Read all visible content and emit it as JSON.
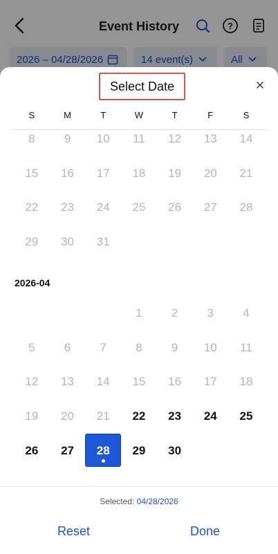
{
  "background": {
    "title": "Event History",
    "date_range": "2026 – 04/28/2026",
    "event_count": "14 event(s)",
    "filter_all": "All"
  },
  "sheet": {
    "title": "Select Date",
    "weekdays": [
      "S",
      "M",
      "T",
      "W",
      "T",
      "F",
      "S"
    ],
    "month_label": "2026-04",
    "previous_month_rows": [
      [
        "8",
        "9",
        "10",
        "11",
        "12",
        "13",
        "14"
      ],
      [
        "15",
        "16",
        "17",
        "18",
        "19",
        "20",
        "21"
      ],
      [
        "22",
        "23",
        "24",
        "25",
        "26",
        "27",
        "28"
      ],
      [
        "29",
        "30",
        "31",
        "",
        "",
        "",
        ""
      ]
    ],
    "april_rows": [
      [
        "",
        "",
        "",
        "1",
        "2",
        "3",
        "4"
      ],
      [
        "5",
        "6",
        "7",
        "8",
        "9",
        "10",
        "11"
      ],
      [
        "12",
        "13",
        "14",
        "15",
        "16",
        "17",
        "18"
      ],
      [
        "19",
        "20",
        "21",
        "22",
        "23",
        "24",
        "25"
      ],
      [
        "26",
        "27",
        "28",
        "29",
        "30",
        "",
        ""
      ]
    ],
    "active_days": [
      "22",
      "23",
      "24",
      "25",
      "26",
      "27",
      "28",
      "29",
      "30"
    ],
    "selected_day": "28",
    "selected_label": "Selected:",
    "selected_value": "04/28/2026",
    "reset_label": "Reset",
    "done_label": "Done"
  },
  "colors": {
    "accent": "#1e58d4",
    "highlight_border": "#e05545",
    "disabled_text": "#b5b5b5"
  }
}
